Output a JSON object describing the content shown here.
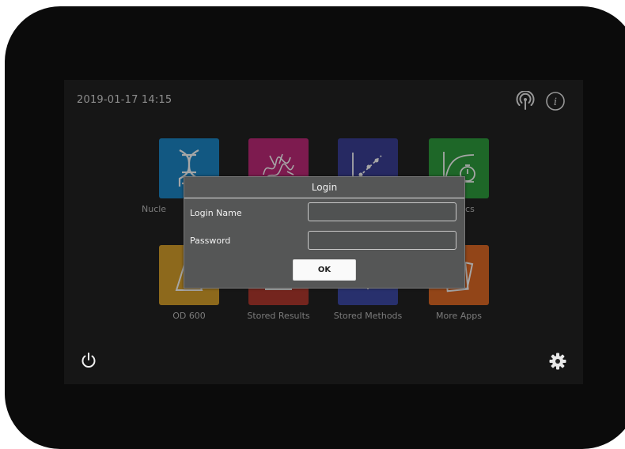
{
  "status_bar": {
    "datetime": "2019-01-17  14:15",
    "icons": [
      "antenna-icon",
      "info-icon"
    ]
  },
  "apps": [
    {
      "label": "Nucleic Acids",
      "visible_label": "Nucle",
      "icon": "dna-icon",
      "color": "#1d88c8"
    },
    {
      "label": "",
      "icon": "protein-icon",
      "color": "#c12a7a"
    },
    {
      "label": "",
      "icon": "standard-curve-icon",
      "color": "#3b3f97"
    },
    {
      "label": "",
      "visible_label": "ics",
      "icon": "kinetics-icon",
      "color": "#2f9e3e"
    },
    {
      "label": "OD 600",
      "icon": "cuvette-icon",
      "color": "#d9a22c"
    },
    {
      "label": "Stored Results",
      "icon": "results-icon",
      "color": "#b33a2e"
    },
    {
      "label": "Stored Methods",
      "icon": "methods-icon",
      "color": "#3e4aa8"
    },
    {
      "label": "More Apps",
      "icon": "more-apps-icon",
      "color": "#e06a25"
    }
  ],
  "login_dialog": {
    "title": "Login",
    "login_name_label": "Login Name",
    "login_name_value": "",
    "password_label": "Password",
    "password_value": "",
    "ok_label": "OK"
  },
  "bottom_bar": {
    "icons": [
      "power-icon",
      "gear-icon"
    ]
  }
}
